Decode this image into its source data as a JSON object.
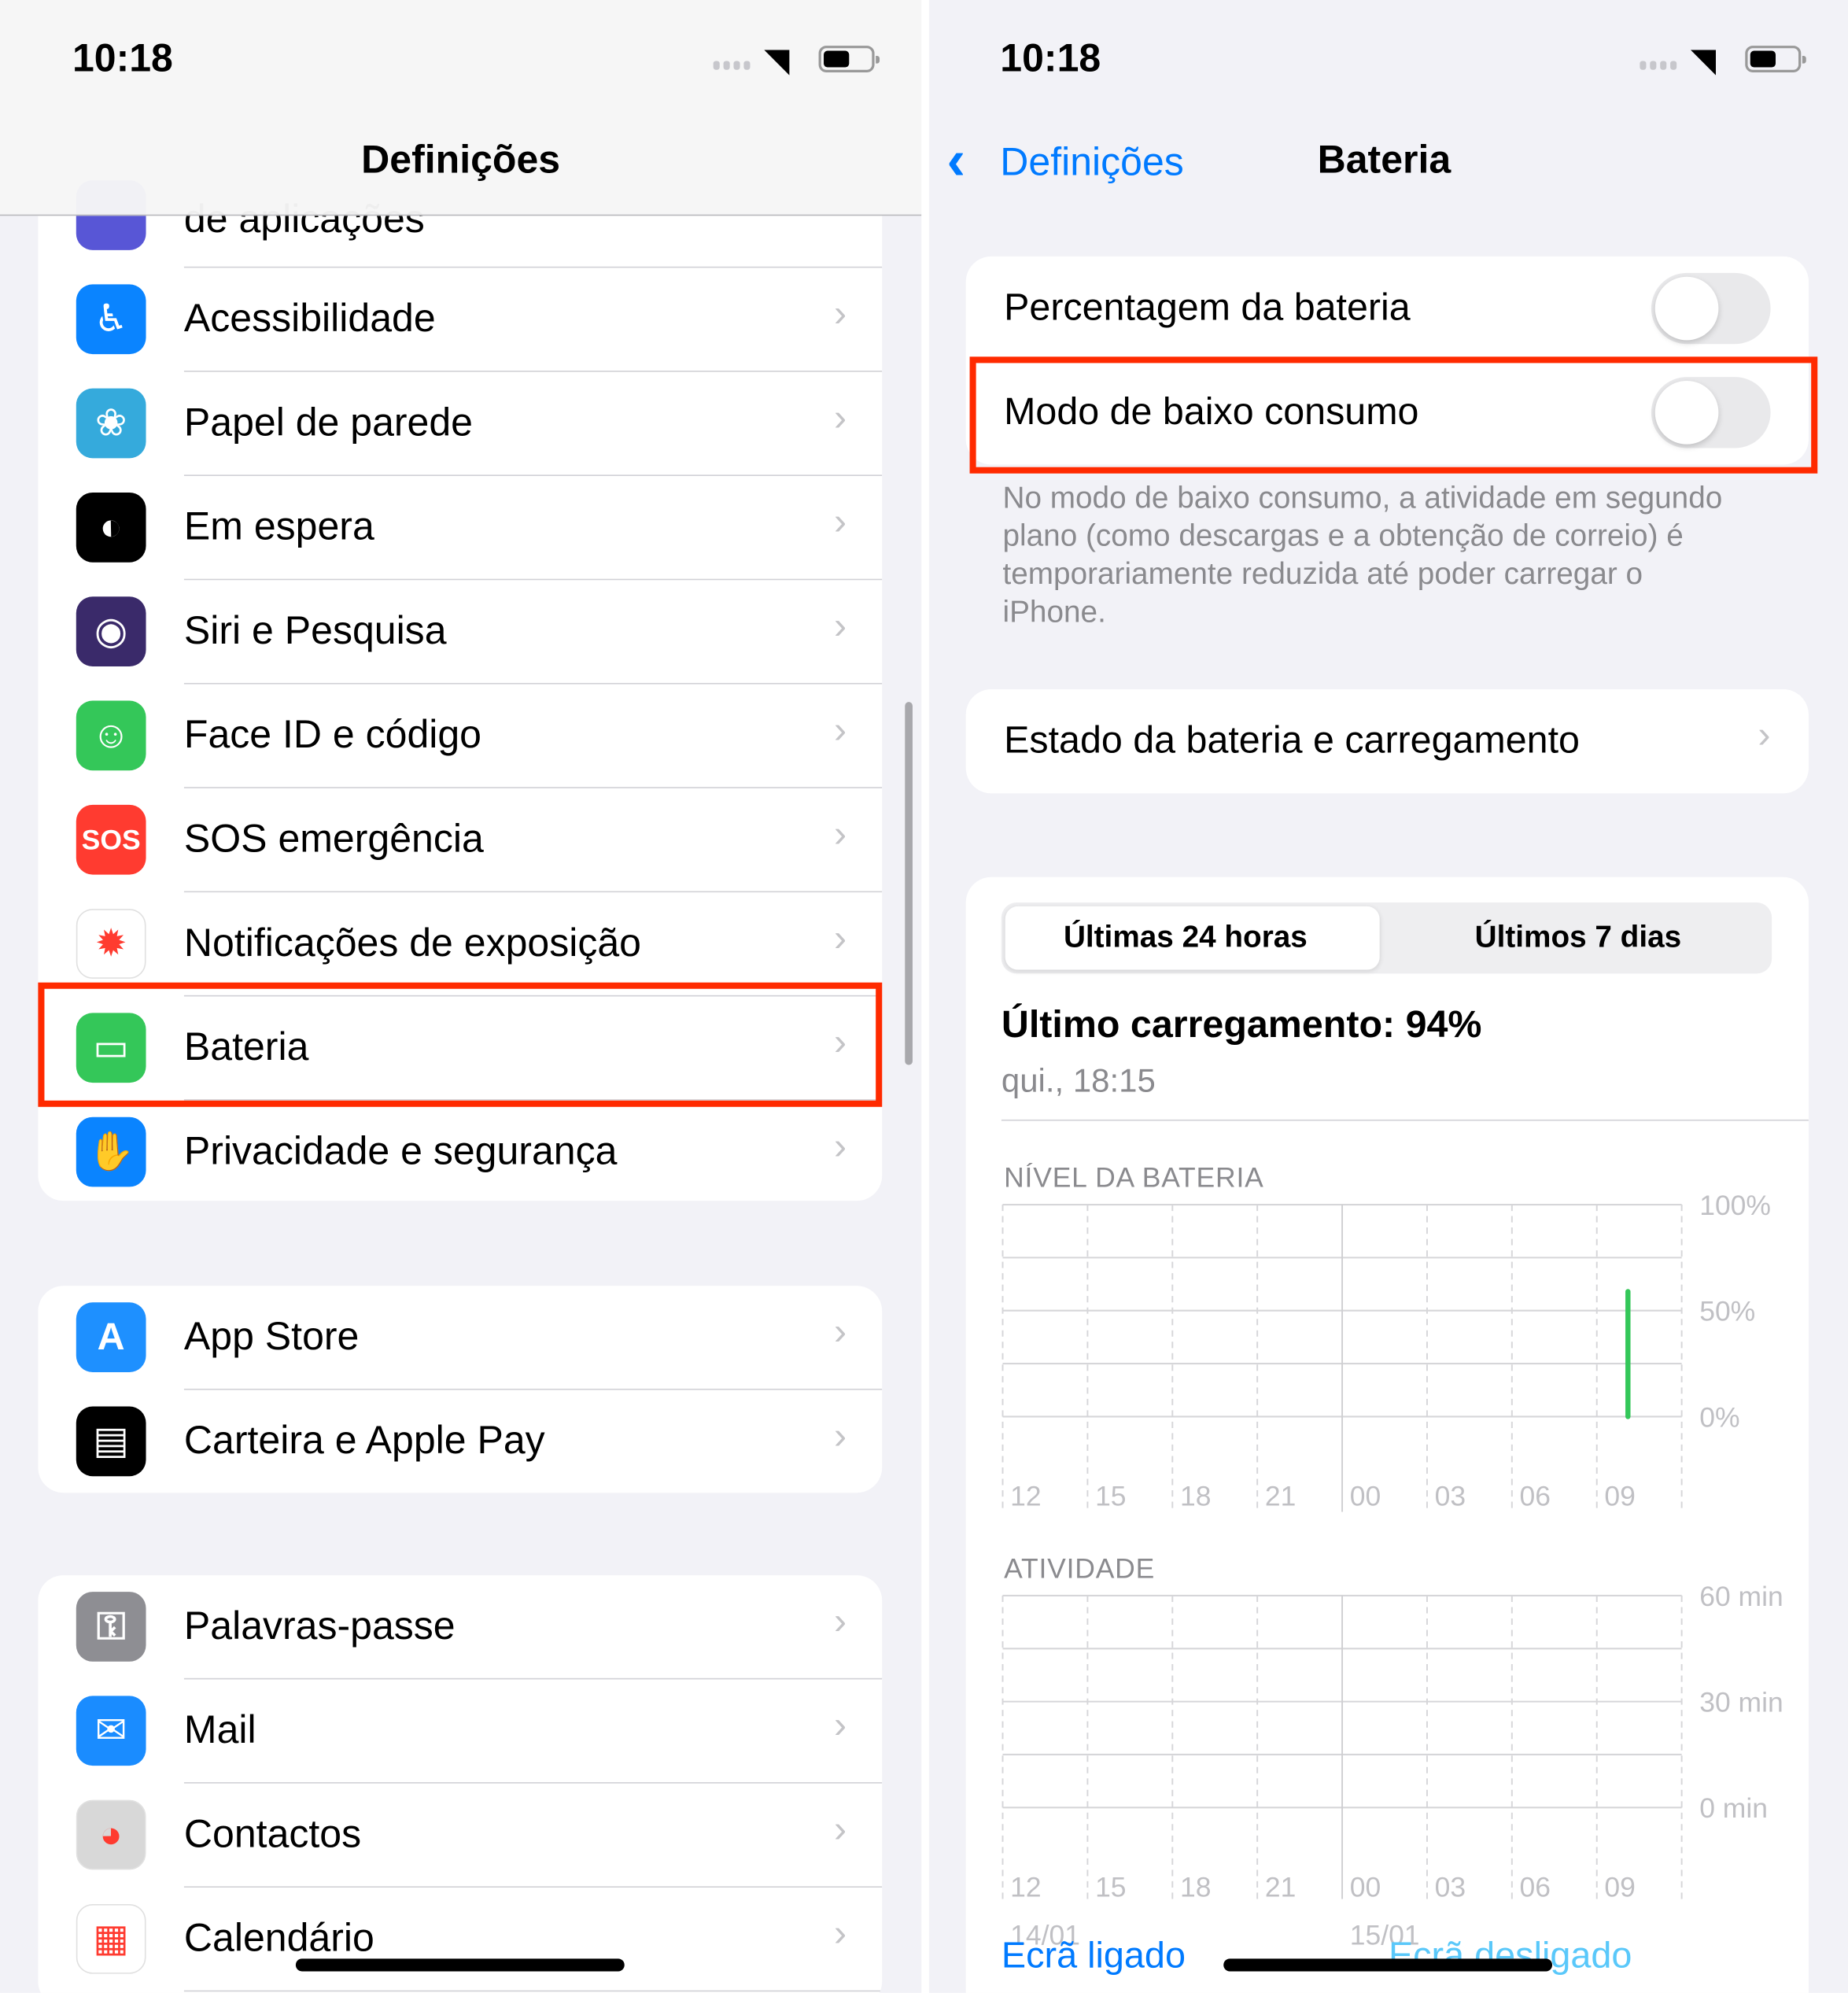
{
  "status_bar": {
    "time": "10:18"
  },
  "left": {
    "title": "Definições",
    "partial_item": "de aplicações",
    "groups": [
      [
        {
          "label": "Acessibilidade",
          "icon": "accessibility-icon",
          "color": "#0a84ff",
          "glyph": "♿"
        },
        {
          "label": "Papel de parede",
          "icon": "wallpaper-flower-icon",
          "color": "#35aadc",
          "glyph": "❀"
        },
        {
          "label": "Em espera",
          "icon": "standby-icon",
          "color": "#000000",
          "glyph": "◐"
        },
        {
          "label": "Siri e Pesquisa",
          "icon": "siri-icon",
          "color": "#3a2a6a",
          "glyph": "◉"
        },
        {
          "label": "Face ID e código",
          "icon": "face-id-icon",
          "color": "#34c759",
          "glyph": "☺"
        },
        {
          "label": "SOS emergência",
          "icon": "sos-icon",
          "color": "#ff3b30",
          "glyph": "SOS"
        },
        {
          "label": "Notificações de exposição",
          "icon": "exposure-notification-icon",
          "color": "#ffffff",
          "glyph": "✹"
        },
        {
          "label": "Bateria",
          "icon": "battery-icon",
          "color": "#34c759",
          "glyph": "▭"
        },
        {
          "label": "Privacidade e segurança",
          "icon": "privacy-hand-icon",
          "color": "#0a84ff",
          "glyph": "✋"
        }
      ],
      [
        {
          "label": "App Store",
          "icon": "app-store-icon",
          "color": "#1e90ff",
          "glyph": "A"
        },
        {
          "label": "Carteira e Apple Pay",
          "icon": "wallet-icon",
          "color": "#000000",
          "glyph": "▤"
        }
      ],
      [
        {
          "label": "Palavras-passe",
          "icon": "key-icon",
          "color": "#8e8e93",
          "glyph": "⚿"
        },
        {
          "label": "Mail",
          "icon": "mail-icon",
          "color": "#1a8cff",
          "glyph": "✉"
        },
        {
          "label": "Contactos",
          "icon": "contacts-icon",
          "color": "#d8d8d8",
          "glyph": "◕"
        },
        {
          "label": "Calendário",
          "icon": "calendar-icon",
          "color": "#ffffff",
          "glyph": "▦"
        }
      ]
    ]
  },
  "right": {
    "back_label": "Definições",
    "title": "Bateria",
    "battery_percentage": {
      "label": "Percentagem da bateria",
      "on": false
    },
    "low_power": {
      "label": "Modo de baixo consumo",
      "on": false
    },
    "low_power_note": "No modo de baixo consumo, a atividade em segundo plano (como descargas e a obtenção de correio) é temporariamente reduzida até poder carregar o iPhone.",
    "health_label": "Estado da bateria e carregamento",
    "segments": [
      "Últimas 24 horas",
      "Últimos 7 dias"
    ],
    "selected_segment": 0,
    "last_charge": "Último carregamento: 94%",
    "last_charge_time": "qui., 18:15",
    "screen_on": "Ecrã ligado",
    "screen_off": "Ecrã desligado"
  },
  "colors": {
    "accent": "#007aff",
    "battery_green": "#34c759",
    "highlight": "#ff2a00",
    "screen_off": "#5ac8fa"
  },
  "chart_data": [
    {
      "type": "bar",
      "title": "NÍVEL DA BATERIA",
      "x_ticks": [
        "12",
        "15",
        "18",
        "21",
        "00",
        "03",
        "06",
        "09"
      ],
      "y_ticks": [
        "100%",
        "50%",
        "0%"
      ],
      "ylim": [
        0,
        100
      ],
      "xlim_hours": [
        0,
        24
      ],
      "series": [
        {
          "x_hour": 22.1,
          "value": 59
        }
      ],
      "grid": true
    },
    {
      "type": "bar",
      "title": "ATIVIDADE",
      "x_ticks": [
        "12",
        "15",
        "18",
        "21",
        "00",
        "03",
        "06",
        "09"
      ],
      "date_labels": [
        "14/01",
        "15/01"
      ],
      "y_ticks": [
        "60 min",
        "30 min",
        "0 min"
      ],
      "ylim": [
        0,
        60
      ],
      "series": [],
      "grid": true
    }
  ]
}
